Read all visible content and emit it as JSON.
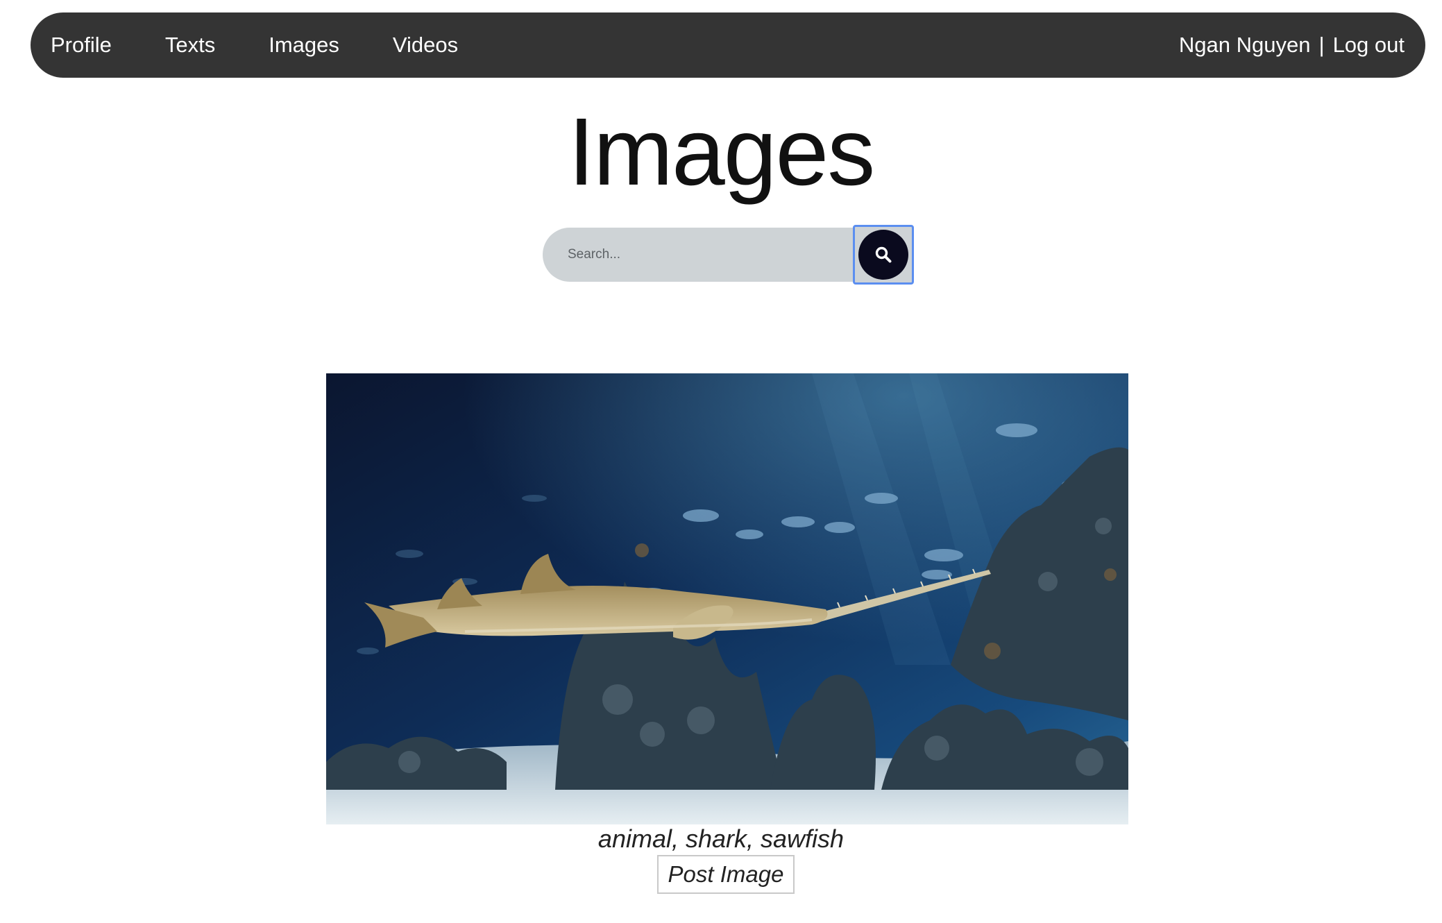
{
  "nav": {
    "links": [
      "Profile",
      "Texts",
      "Images",
      "Videos"
    ],
    "user_name": "Ngan Nguyen",
    "separator": "|",
    "logout": "Log out"
  },
  "page": {
    "title": "Images"
  },
  "search": {
    "placeholder": "Search...",
    "button_icon": "search-icon"
  },
  "post": {
    "image_subject": "sawfish-aquarium-photo",
    "tags": "animal, shark, sawfish",
    "post_button_label": "Post Image"
  },
  "colors": {
    "navbar": "#343434",
    "search_field": "#ced3d6",
    "search_button": "#0a0a1e",
    "focus_outline": "#5b8ef0"
  }
}
